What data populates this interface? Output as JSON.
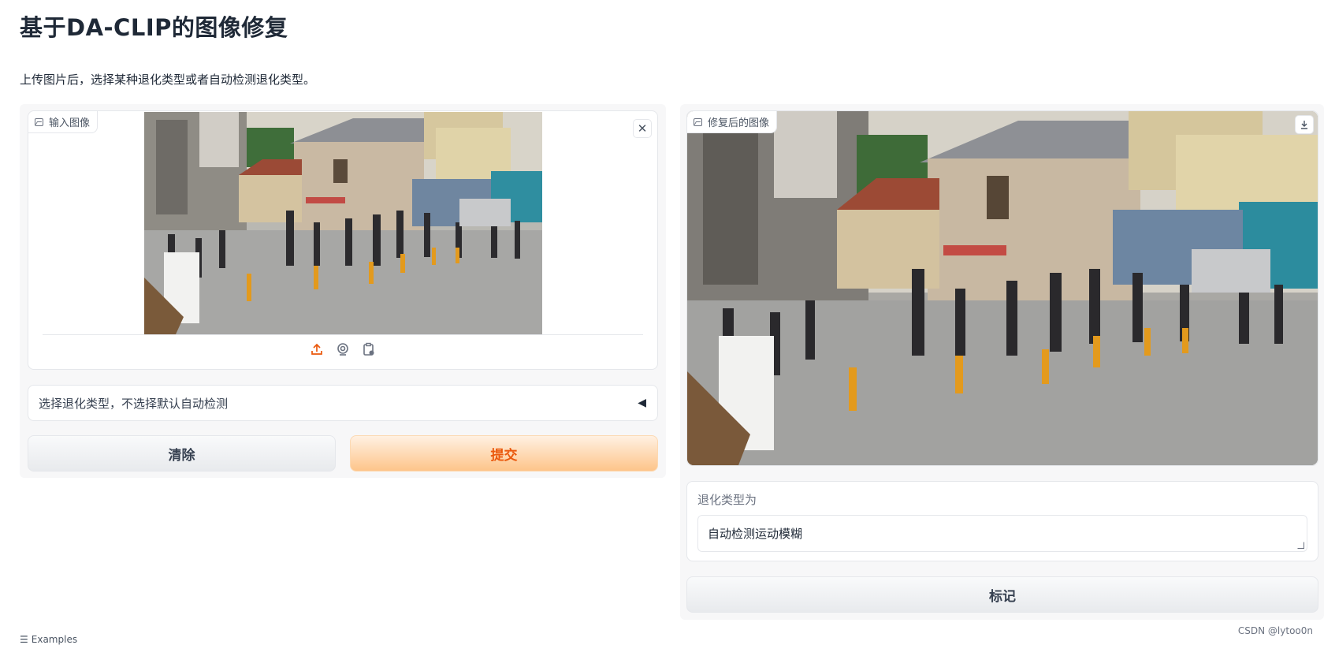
{
  "page": {
    "title": "基于DA-CLIP的图像修复",
    "description": "上传图片后，选择某种退化类型或者自动检测退化类型。"
  },
  "input_image": {
    "label": "输入图像",
    "label_icon": "image-icon",
    "close_icon": "close-icon",
    "source_icons": [
      "upload-icon",
      "webcam-icon",
      "clipboard-icon"
    ]
  },
  "output_image": {
    "label": "修复后的图像",
    "label_icon": "image-icon",
    "download_icon": "download-icon"
  },
  "degradation_select": {
    "placeholder": "选择退化类型，不选择默认自动检测",
    "caret_icon": "caret-left-icon"
  },
  "buttons": {
    "clear": "清除",
    "submit": "提交",
    "flag": "标记"
  },
  "result": {
    "label": "退化类型为",
    "value": "自动检测运动模糊"
  },
  "examples": {
    "icon": "list-icon",
    "label": "Examples"
  },
  "watermark": "CSDN @lytoo0n",
  "colors": {
    "accent": "#ea580c",
    "submit_gradient_end": "#fdc58a"
  }
}
